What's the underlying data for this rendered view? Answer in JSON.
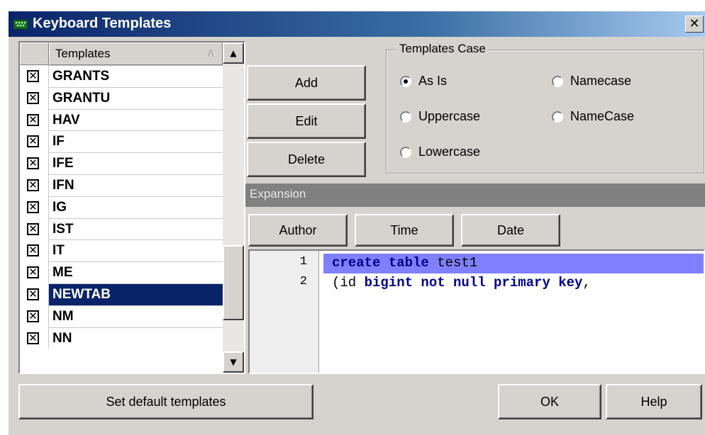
{
  "window": {
    "title": "Keyboard Templates",
    "close_symbol": "✕"
  },
  "template_list": {
    "column_header": "Templates",
    "sort_arrow": "/\\",
    "check_mark": "✕",
    "items": [
      {
        "name": "GRANTS",
        "checked": true,
        "selected": false
      },
      {
        "name": "GRANTU",
        "checked": true,
        "selected": false
      },
      {
        "name": "HAV",
        "checked": true,
        "selected": false
      },
      {
        "name": "IF",
        "checked": true,
        "selected": false
      },
      {
        "name": "IFE",
        "checked": true,
        "selected": false
      },
      {
        "name": "IFN",
        "checked": true,
        "selected": false
      },
      {
        "name": "IG",
        "checked": true,
        "selected": false
      },
      {
        "name": "IST",
        "checked": true,
        "selected": false
      },
      {
        "name": "IT",
        "checked": true,
        "selected": false
      },
      {
        "name": "ME",
        "checked": true,
        "selected": false
      },
      {
        "name": "NEWTAB",
        "checked": true,
        "selected": true
      },
      {
        "name": "NM",
        "checked": true,
        "selected": false
      },
      {
        "name": "NN",
        "checked": true,
        "selected": false
      }
    ],
    "scroll_up_symbol": "▲",
    "scroll_down_symbol": "▼"
  },
  "actions": {
    "add_label": "Add",
    "edit_label": "Edit",
    "delete_label": "Delete"
  },
  "templates_case": {
    "label": "Templates Case",
    "options": [
      {
        "label": "As Is",
        "selected": true
      },
      {
        "label": "Namecase",
        "selected": false
      },
      {
        "label": "Uppercase",
        "selected": false
      },
      {
        "label": "NameCase",
        "selected": false
      },
      {
        "label": "Lowercase",
        "selected": false
      }
    ]
  },
  "expansion": {
    "header": "Expansion",
    "insert_buttons": {
      "author": "Author",
      "time": "Time",
      "date": "Date"
    },
    "line_numbers": [
      "1",
      "2"
    ],
    "code_lines": [
      {
        "parts": [
          {
            "text": "create table",
            "kw": true
          },
          {
            "text": " test1",
            "kw": false
          }
        ],
        "highlighted": true
      },
      {
        "parts": [
          {
            "text": "(id ",
            "kw": false
          },
          {
            "text": "bigint not null primary key",
            "kw": true
          },
          {
            "text": ",",
            "kw": false
          }
        ],
        "highlighted": false
      }
    ]
  },
  "footer": {
    "set_default_label": "Set default templates",
    "ok_label": "OK",
    "help_label": "Help"
  },
  "colors": {
    "titlebar_start": "#0a246a",
    "selection": "#0a246a",
    "line_highlight": "#8080ff",
    "dialog_face": "#d6d3ce"
  }
}
